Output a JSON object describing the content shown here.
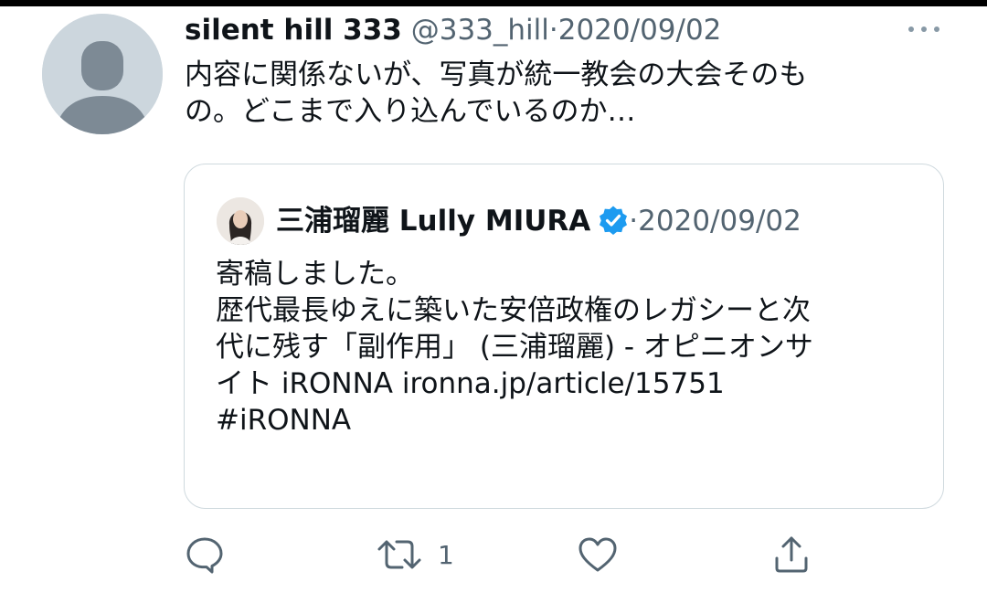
{
  "tweet": {
    "author_name": "silent hill 333",
    "handle": "@333_hill",
    "separator": "·",
    "date": "2020/09/02",
    "text_lines": [
      "内容に関係ないが、写真が統一教会の大会そのも",
      "の。どこまで入り込んでいるのか…"
    ],
    "more_icon": "more-dots-icon"
  },
  "quote": {
    "author_name": "三浦瑠麗 Lully MIURA",
    "verified_icon": "verified-badge-icon",
    "separator": "·",
    "date": "2020/09/02",
    "text_lines": [
      "寄稿しました。",
      "歴代最長ゆえに築いた安倍政権のレガシーと次",
      "代に残す「副作用」 (三浦瑠麗) - オピニオンサ",
      "イト iRONNA ironna.jp/article/15751",
      "#iRONNA"
    ]
  },
  "actions": {
    "reply_icon": "reply-icon",
    "retweet_icon": "retweet-icon",
    "retweet_count": "1",
    "like_icon": "heart-icon",
    "share_icon": "share-icon"
  },
  "colors": {
    "text": "#0f1419",
    "secondary": "#536471",
    "border": "#cfd9de",
    "verified": "#1d9bf0",
    "avatar_placeholder": "#ccd6dd"
  }
}
